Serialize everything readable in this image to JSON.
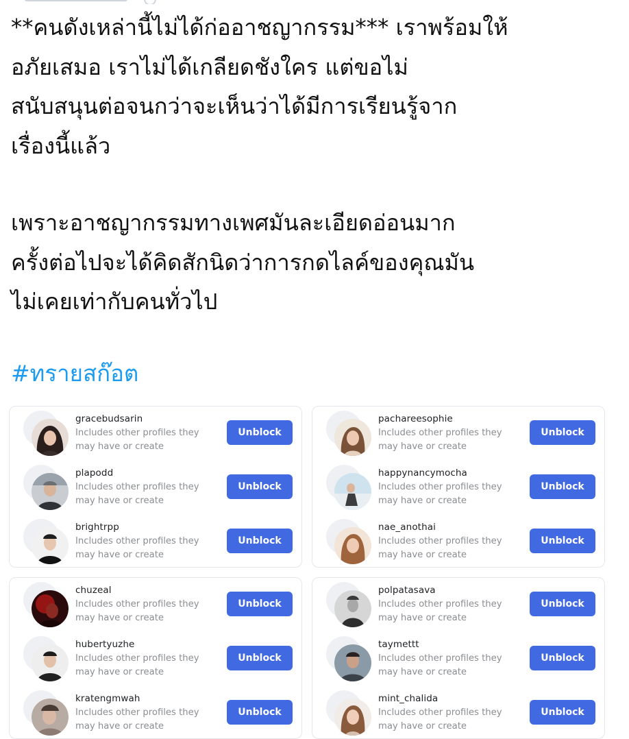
{
  "tweet": {
    "paragraph_1": [
      "**คนดังเหล่านี้ไม่ได้ก่ออาชญากรรม*** เราพร้อมให้",
      "อภัยเสมอ เราไม่ได้เกลียดชังใคร แต่ขอไม่",
      "สนับสนุนต่อจนกว่าจะเห็นว่าได้มีการเรียนรู้จาก",
      "เรื่องนี้แล้ว"
    ],
    "paragraph_2": [
      "เพราะอาชญากรรมทางเพศมันละเอียดอ่อนมาก",
      "ครั้งต่อไปจะได้คิดสักนิดว่าการกดไลค์ของคุณมัน",
      "ไม่เคยเท่ากับคนทั่วไป"
    ],
    "hashtag": "#ทรายสก๊อต"
  },
  "colors": {
    "hashtag": "#1d9bf0",
    "unblock_button": "#4169e1",
    "description_text": "#8a8d91"
  },
  "blocked_panels": [
    {
      "accounts": [
        {
          "username": "gracebudsarin",
          "description": [
            "Includes other profiles they",
            "may have or create"
          ],
          "button_label": "Unblock"
        },
        {
          "username": "plapodd",
          "description": [
            "Includes other profiles they",
            "may have or create"
          ],
          "button_label": "Unblock"
        },
        {
          "username": "brightrpp",
          "description": [
            "Includes other profiles they",
            "may have or create"
          ],
          "button_label": "Unblock"
        }
      ]
    },
    {
      "accounts": [
        {
          "username": "pachareesophie",
          "description": [
            "Includes other profiles they",
            "may have or create"
          ],
          "button_label": "Unblock"
        },
        {
          "username": "happynancymocha",
          "description": [
            "Includes other profiles they",
            "may have or create"
          ],
          "button_label": "Unblock"
        },
        {
          "username": "nae_anothai",
          "description": [
            "Includes other profiles they",
            "may have or create"
          ],
          "button_label": "Unblock"
        }
      ]
    },
    {
      "accounts": [
        {
          "username": "chuzeal",
          "description": [
            "Includes other profiles they",
            "may have or create"
          ],
          "button_label": "Unblock"
        },
        {
          "username": "hubertyuzhe",
          "description": [
            "Includes other profiles they",
            "may have or create"
          ],
          "button_label": "Unblock"
        },
        {
          "username": "kratengmwah",
          "description": [
            "Includes other profiles they",
            "may have or create"
          ],
          "button_label": "Unblock"
        }
      ]
    },
    {
      "accounts": [
        {
          "username": "polpatasava",
          "description": [
            "Includes other profiles they",
            "may have or create"
          ],
          "button_label": "Unblock"
        },
        {
          "username": "taymettt",
          "description": [
            "Includes other profiles they",
            "may have or create"
          ],
          "button_label": "Unblock"
        },
        {
          "username": "mint_chalida",
          "description": [
            "Includes other profiles they",
            "may have or create"
          ],
          "button_label": "Unblock"
        }
      ]
    }
  ]
}
